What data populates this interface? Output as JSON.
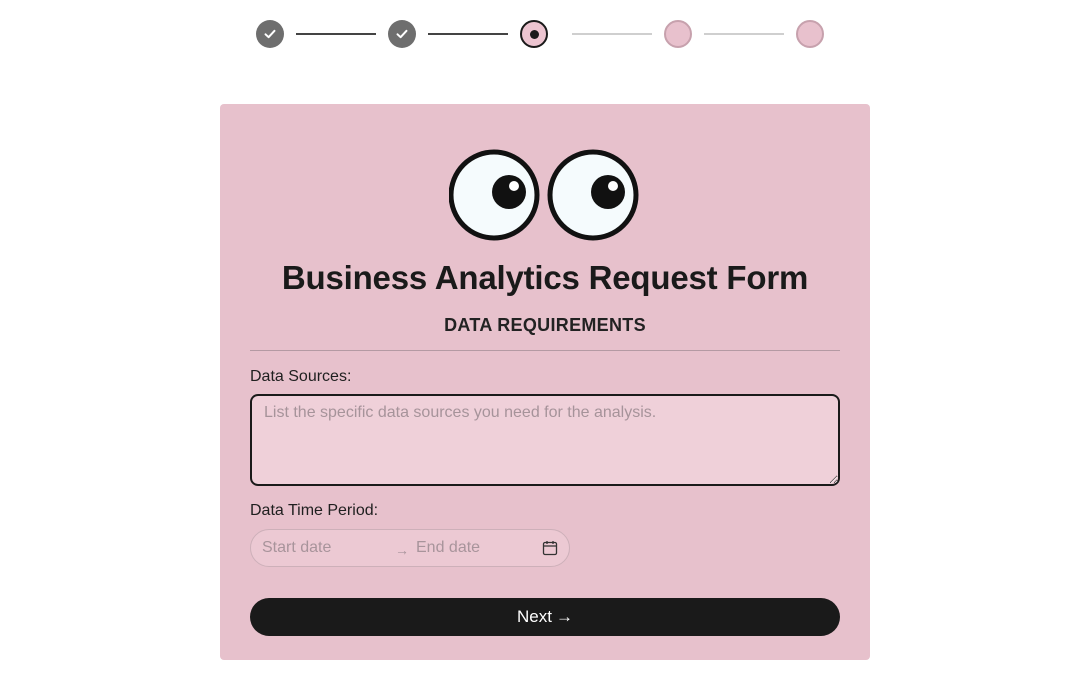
{
  "stepper": {
    "steps": [
      {
        "state": "done"
      },
      {
        "state": "done"
      },
      {
        "state": "current"
      },
      {
        "state": "todo"
      },
      {
        "state": "todo"
      }
    ]
  },
  "form": {
    "title": "Business Analytics Request Form",
    "section": "DATA REQUIREMENTS",
    "sources_label": "Data Sources:",
    "sources_placeholder": "List the specific data sources you need for the analysis.",
    "sources_value": "",
    "period_label": "Data Time Period:",
    "start_placeholder": "Start date",
    "end_placeholder": "End date",
    "range_separator": "→",
    "next_label": "Next",
    "next_arrow": "→"
  },
  "colors": {
    "card_bg": "#e7c1cc",
    "button_bg": "#1a1a1a",
    "step_done": "#6e6e6e",
    "step_todo": "#e8c1cd"
  },
  "icons": {
    "step_done": "check-icon",
    "step_current": "dot-icon",
    "mascot": "googly-eyes-icon",
    "date": "calendar-icon",
    "next": "arrow-right-icon"
  }
}
